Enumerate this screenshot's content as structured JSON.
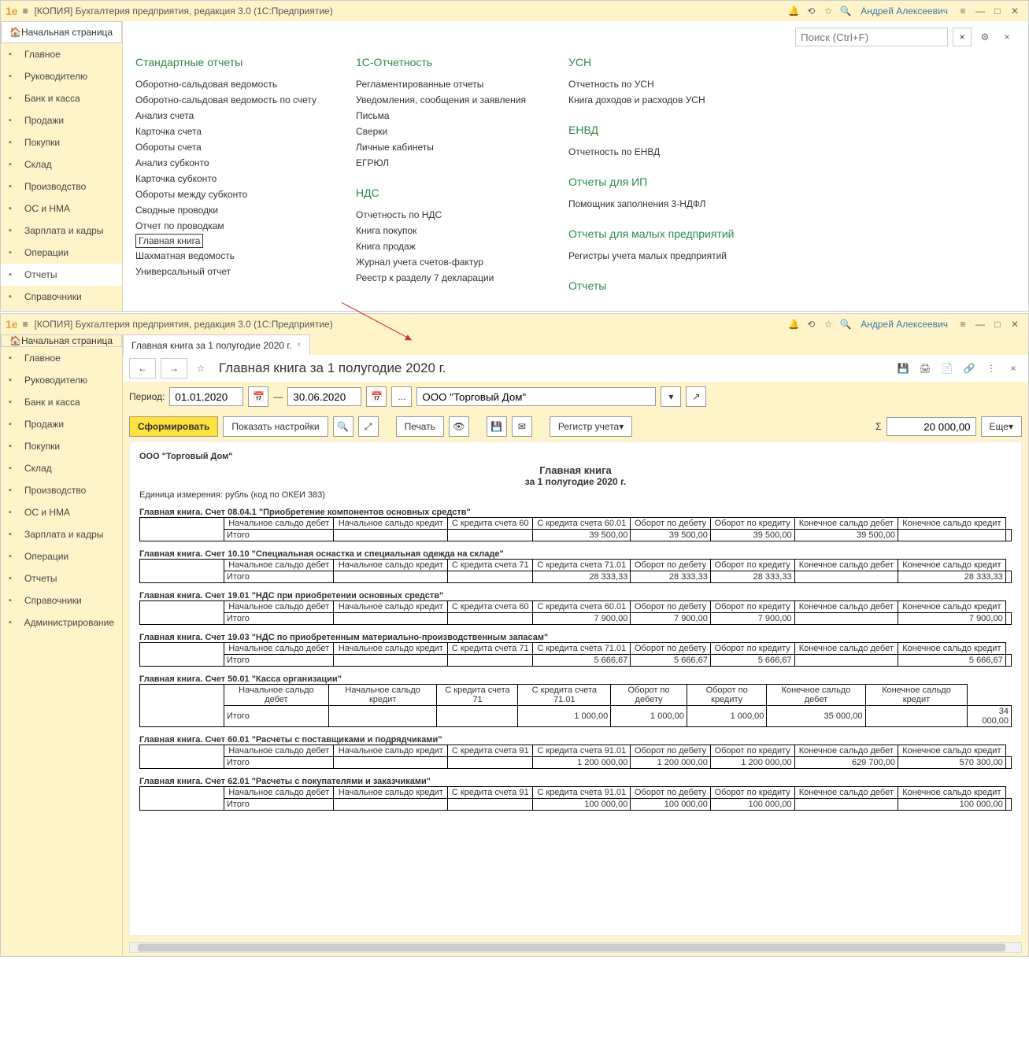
{
  "app": {
    "title": "[КОПИЯ] Бухгалтерия предприятия, редакция 3.0  (1С:Предприятие)",
    "user": "Андрей Алексеевич"
  },
  "home": "Начальная страница",
  "search": {
    "placeholder": "Поиск (Ctrl+F)"
  },
  "nav": [
    "Главное",
    "Руководителю",
    "Банк и касса",
    "Продажи",
    "Покупки",
    "Склад",
    "Производство",
    "ОС и НМА",
    "Зарплата и кадры",
    "Операции",
    "Отчеты",
    "Справочники"
  ],
  "nav2": [
    "Главное",
    "Руководителю",
    "Банк и касса",
    "Продажи",
    "Покупки",
    "Склад",
    "Производство",
    "ОС и НМА",
    "Зарплата и кадры",
    "Операции",
    "Отчеты",
    "Справочники",
    "Администрирование"
  ],
  "cols": {
    "c1": {
      "title": "Стандартные отчеты",
      "items": [
        "Оборотно-сальдовая ведомость",
        "Оборотно-сальдовая ведомость по счету",
        "Анализ счета",
        "Карточка счета",
        "Обороты счета",
        "Анализ субконто",
        "Карточка субконто",
        "Обороты между субконто",
        "Сводные проводки",
        "Отчет по проводкам",
        "Главная книга",
        "Шахматная ведомость",
        "Универсальный отчет"
      ]
    },
    "c2a": {
      "title": "1С-Отчетность",
      "items": [
        "Регламентированные отчеты",
        "Уведомления, сообщения и заявления",
        "Письма",
        "Сверки",
        "Личные кабинеты",
        "ЕГРЮЛ"
      ]
    },
    "c2b": {
      "title": "НДС",
      "items": [
        "Отчетность по НДС",
        "Книга покупок",
        "Книга продаж",
        "Журнал учета счетов-фактур",
        "Реестр к разделу 7 декларации"
      ]
    },
    "c3a": {
      "title": "УСН",
      "items": [
        "Отчетность по УСН",
        "Книга доходов и расходов УСН"
      ]
    },
    "c3b": {
      "title": "ЕНВД",
      "items": [
        "Отчетность по ЕНВД"
      ]
    },
    "c3c": {
      "title": "Отчеты для ИП",
      "items": [
        "Помощник заполнения 3-НДФЛ"
      ]
    },
    "c3d": {
      "title": "Отчеты для малых предприятий",
      "items": [
        "Регистры учета малых предприятий"
      ]
    },
    "c3e": {
      "title": "Отчеты"
    }
  },
  "tab": "Главная книга за 1 полугодие 2020 г.",
  "hdr": "Главная книга за 1 полугодие 2020 г.",
  "period": {
    "label": "Период:",
    "from": "01.01.2020",
    "to": "30.06.2020",
    "dash": "—",
    "org": "ООО \"Торговый Дом\""
  },
  "actions": {
    "form": "Сформировать",
    "settings": "Показать настройки",
    "print": "Печать",
    "reg": "Регистр учета",
    "more": "Еще",
    "amount": "20 000,00"
  },
  "report": {
    "org": "ООО \"Торговый Дом\"",
    "title": "Главная книга",
    "sub": "за 1 полугодие 2020 г.",
    "unit": "Единица измерения: рубль (код по ОКЕИ 383)",
    "headers": [
      "Начальное сальдо дебет",
      "Начальное сальдо кредит"
    ],
    "tail": [
      "Оборот по дебету",
      "Оборот по кредиту",
      "Конечное сальдо дебет",
      "Конечное сальдо кредит"
    ],
    "itogo": "Итого",
    "tables": [
      {
        "title": "Главная книга. Счет 08.04.1 \"Приобретение компонентов основных средств\"",
        "sc1": "С кредита счета 60",
        "sc2": "С кредита счета 60.01",
        "vals": [
          "39 500,00",
          "39 500,00",
          "39 500,00",
          "39 500,00",
          "",
          ""
        ]
      },
      {
        "title": "Главная книга. Счет 10.10 \"Специальная оснастка и специальная одежда на складе\"",
        "sc1": "С кредита счета 71",
        "sc2": "С кредита счета 71.01",
        "vals": [
          "28 333,33",
          "28 333,33",
          "28 333,33",
          "",
          "28 333,33",
          ""
        ]
      },
      {
        "title": "Главная книга. Счет 19.01 \"НДС при приобретении основных средств\"",
        "sc1": "С кредита счета 60",
        "sc2": "С кредита счета 60.01",
        "vals": [
          "7 900,00",
          "7 900,00",
          "7 900,00",
          "",
          "7 900,00",
          ""
        ]
      },
      {
        "title": "Главная книга. Счет 19.03 \"НДС по приобретенным материально-производственным запасам\"",
        "sc1": "С кредита счета 71",
        "sc2": "С кредита счета 71.01",
        "vals": [
          "5 666,67",
          "5 666,67",
          "5 666,67",
          "",
          "5 666,67",
          ""
        ]
      },
      {
        "title": "Главная книга. Счет 50.01 \"Касса организации\"",
        "sc1": "С кредита счета 71",
        "sc2": "С кредита счета 71.01",
        "vals": [
          "1 000,00",
          "1 000,00",
          "1 000,00",
          "35 000,00",
          "",
          "34 000,00"
        ]
      },
      {
        "title": "Главная книга. Счет 60.01 \"Расчеты с поставщиками и подрядчиками\"",
        "sc1": "С кредита счета 91",
        "sc2": "С кредита счета 91.01",
        "vals": [
          "1 200 000,00",
          "1 200 000,00",
          "1 200 000,00",
          "629 700,00",
          "570 300,00",
          ""
        ]
      },
      {
        "title": "Главная книга. Счет 62.01 \"Расчеты с покупателями и заказчиками\"",
        "sc1": "С кредита счета 91",
        "sc2": "С кредита счета 91.01",
        "vals": [
          "100 000,00",
          "100 000,00",
          "100 000,00",
          "",
          "100 000,00",
          ""
        ]
      }
    ]
  }
}
